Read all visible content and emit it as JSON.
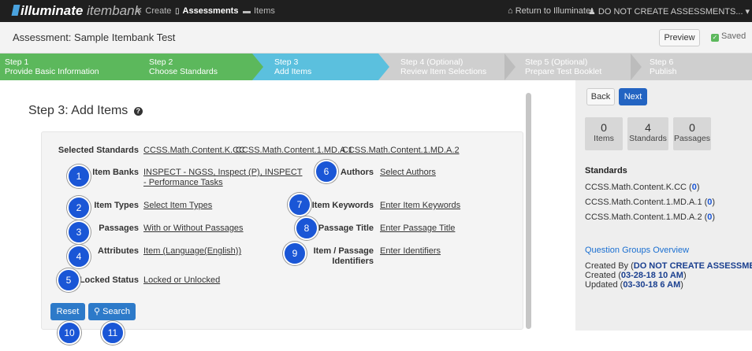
{
  "topnav": {
    "brand_bold": "illuminate",
    "brand_light": "itembank",
    "create": "Create",
    "assessments": "Assessments",
    "items": "Items",
    "return": "Return to Illuminate",
    "user": "DO NOT CREATE ASSESSMENTS..."
  },
  "header": {
    "title": "Assessment: Sample Itembank Test",
    "preview": "Preview",
    "saved": "Saved"
  },
  "steps": [
    {
      "num": "Step 1",
      "label": "Provide Basic Information",
      "state": "done",
      "color": "#5cb85c"
    },
    {
      "num": "Step 2",
      "label": "Choose Standards",
      "state": "done",
      "color": "#5cb85c"
    },
    {
      "num": "Step 3",
      "label": "Add Items",
      "state": "active",
      "color": "#5bc0de"
    },
    {
      "num": "Step 4 (Optional)",
      "label": "Review Item Selections",
      "state": "todo",
      "color": "#cfcfcf"
    },
    {
      "num": "Step 5 (Optional)",
      "label": "Prepare Test Booklet",
      "state": "todo",
      "color": "#cfcfcf"
    },
    {
      "num": "Step 6",
      "label": "Publish",
      "state": "todo",
      "color": "#cfcfcf"
    }
  ],
  "main": {
    "title": "Step 3: Add Items",
    "selected_standards_label": "Selected Standards",
    "selected_standards": [
      "CCSS.Math.Content.K.CC",
      "CCSS.Math.Content.1.MD.A.1",
      "CCSS.Math.Content.1.MD.A.2"
    ],
    "filters": {
      "item_banks_label": "Item Banks",
      "item_banks_value_1": "INSPECT - NGSS, Inspect (P), INSPECT",
      "item_banks_value_2": "- Performance Tasks",
      "item_types_label": "Item Types",
      "item_types_value": "Select Item Types",
      "passages_label": "Passages",
      "passages_value": "With or Without Passages",
      "attributes_label": "Attributes",
      "attributes_value": "Item (Language(English))",
      "locked_label": "Locked Status",
      "locked_value": "Locked or Unlocked",
      "authors_label": "Authors",
      "authors_value": "Select Authors",
      "keywords_label": "Item Keywords",
      "keywords_value": "Enter Item Keywords",
      "passage_title_label": "Passage Title",
      "passage_title_value": "Enter Passage Title",
      "identifiers_label_1": "Item / Passage",
      "identifiers_label_2": "Identifiers",
      "identifiers_value": "Enter Identifiers"
    },
    "reset": "Reset",
    "search": "Search",
    "badges": [
      "1",
      "2",
      "3",
      "4",
      "5",
      "6",
      "7",
      "8",
      "9",
      "10",
      "11"
    ]
  },
  "sidebar": {
    "back": "Back",
    "next": "Next",
    "stats": [
      {
        "num": "0",
        "cap": "Items"
      },
      {
        "num": "4",
        "cap": "Standards"
      },
      {
        "num": "0",
        "cap": "Passages"
      }
    ],
    "standards_heading": "Standards",
    "standards": [
      {
        "name": "CCSS.Math.Content.K.CC (",
        "count": "0",
        "close": ")"
      },
      {
        "name": "CCSS.Math.Content.1.MD.A.1 (",
        "count": "0",
        "close": ")"
      },
      {
        "name": "CCSS.Math.Content.1.MD.A.2 (",
        "count": "0",
        "close": ")"
      }
    ],
    "question_groups": "Question Groups Overview",
    "created_by_prefix": "Created By (",
    "created_by": "DO NOT CREATE ASSESSMENTS,",
    "created_prefix": "Created (",
    "created": "03-28-18 10 AM",
    "created_suffix": ")",
    "updated_prefix": "Updated (",
    "updated": "03-30-18 6 AM",
    "updated_suffix": ")"
  },
  "colors": {
    "accent": "#1a56d6",
    "step_done": "#5cb85c",
    "step_active": "#5bc0de",
    "step_todo": "#cfcfcf"
  }
}
